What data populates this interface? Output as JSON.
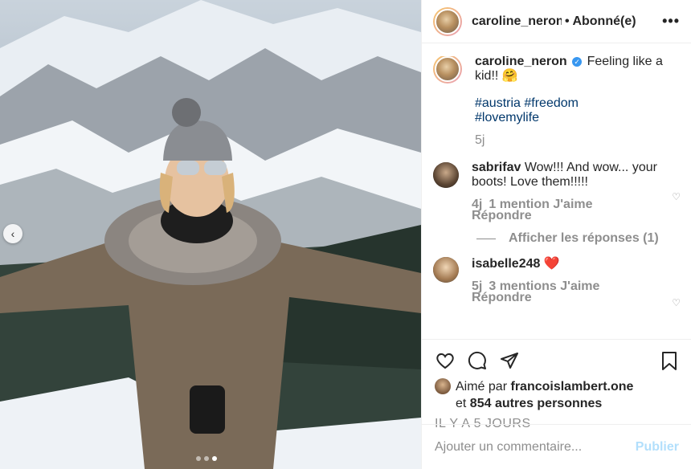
{
  "header": {
    "username": "caroline_neron",
    "follow_status": "• Abonné(e)"
  },
  "caption": {
    "username": "caroline_neron",
    "text": "Feeling like a kid!! 🤗",
    "hashtags": [
      "#austria",
      "#freedom",
      "#lovemylife"
    ],
    "time": "5j"
  },
  "comments": [
    {
      "username": "sabrifav",
      "text": "Wow!!! And wow... your boots! Love them!!!!!",
      "time": "4j",
      "likes": "1 mention J'aime",
      "reply": "Répondre",
      "view_replies": "Afficher les réponses (1)"
    },
    {
      "username": "isabelle248",
      "text": "❤️",
      "time": "5j",
      "likes": "3 mentions J'aime",
      "reply": "Répondre"
    }
  ],
  "likes": {
    "prefix": "Aimé par",
    "user": "francoislambert.one",
    "connector": "et",
    "others": "854 autres personnes"
  },
  "posted_ago": "IL Y A 5 JOURS",
  "comment_box": {
    "placeholder": "Ajouter un commentaire...",
    "publish_label": "Publier"
  },
  "icons": {
    "more": "more-icon",
    "verified": "verified-icon",
    "like": "heart-icon",
    "comment": "comment-icon",
    "share": "share-icon",
    "save": "bookmark-icon",
    "carousel_prev": "chevron-left-icon"
  },
  "colors": {
    "link": "#00376b",
    "muted": "#8e8e8e",
    "publish_disabled": "#b2dffc",
    "verified": "#3897f0"
  },
  "carousel": {
    "slide_count": 3,
    "active_slide": 3
  }
}
